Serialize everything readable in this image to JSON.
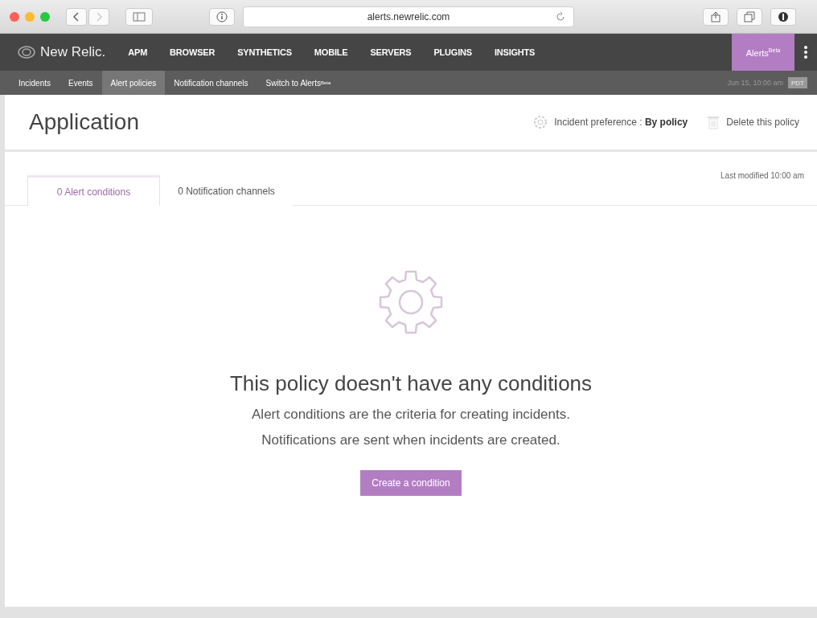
{
  "browser": {
    "url": "alerts.newrelic.com"
  },
  "top_nav": {
    "brand": "New Relic.",
    "items": [
      {
        "label": "APM"
      },
      {
        "label": "BROWSER"
      },
      {
        "label": "SYNTHETICS"
      },
      {
        "label": "MOBILE"
      },
      {
        "label": "SERVERS"
      },
      {
        "label": "PLUGINS"
      },
      {
        "label": "INSIGHTS"
      }
    ],
    "alerts_button": {
      "label": "Alerts",
      "badge": "Beta"
    }
  },
  "sub_nav": {
    "items": [
      {
        "label": "Incidents",
        "selected": false
      },
      {
        "label": "Events",
        "selected": false
      },
      {
        "label": "Alert policies",
        "selected": true
      },
      {
        "label": "Notification channels",
        "selected": false
      },
      {
        "label": "Switch to Alerts$^{Beta}$",
        "selected": false
      }
    ],
    "time": "Jun 15, 10:00 am",
    "timezone": "PDT"
  },
  "header": {
    "title": "Application",
    "incident_preference": "Incident preference : **By policy**",
    "delete": "Delete this policy"
  },
  "tabs": [
    {
      "label": "0 Alert conditions",
      "selected": true
    },
    {
      "label": "0 Notification channels",
      "selected": false
    }
  ],
  "last_modified": "Last modified 10:00 am",
  "empty_state": {
    "title": "This policy doesn't have any conditions",
    "lines": [
      "Alert conditions are the criteria for creating incidents.",
      "Notifications are sent when incidents are created."
    ],
    "button": "Create a condition"
  }
}
